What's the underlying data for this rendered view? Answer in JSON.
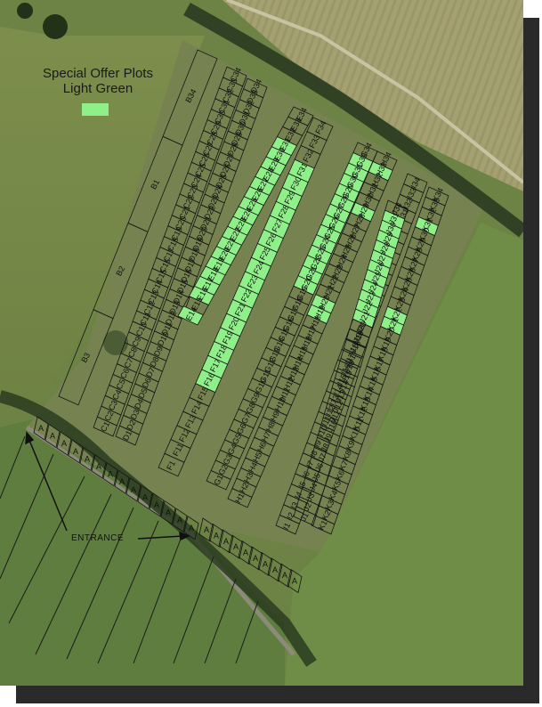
{
  "legend": {
    "line1": "Special Offer Plots",
    "line2": "Light Green",
    "swatch_color": "#8ff08a"
  },
  "entrance_label": "ENTRANCE",
  "plots": {
    "B": [
      "B34",
      "B1",
      "B2",
      "B3"
    ],
    "C": [
      "C34",
      "C33",
      "C32",
      "C31",
      "C30",
      "C29",
      "C28",
      "C27",
      "C26",
      "C25",
      "C24",
      "C23",
      "C22",
      "C21",
      "C20",
      "C19",
      "C18",
      "C17",
      "C16",
      "C15",
      "C14",
      "C13",
      "C12",
      "C11",
      "C10",
      "C9",
      "C8",
      "C7",
      "C6",
      "C5",
      "C4",
      "C3",
      "C2",
      "C1"
    ],
    "D": [
      "D34",
      "D33",
      "D32",
      "D31",
      "D30",
      "D29",
      "D28",
      "D27",
      "D26",
      "D25",
      "D24",
      "D23",
      "D22",
      "D21",
      "D20",
      "D19",
      "D18",
      "D17",
      "D16",
      "D15",
      "D14",
      "D13",
      "D12",
      "D11",
      "D10",
      "D9",
      "D8",
      "D7",
      "D6",
      "D5",
      "D4",
      "D3",
      "D2",
      "D1"
    ],
    "E": [
      "E34",
      "E33",
      "E32",
      "E31",
      "E30",
      "E29",
      "E28",
      "E27",
      "E26",
      "E25",
      "E24",
      "E23",
      "E22",
      "E21",
      "E20",
      "E19",
      "E18",
      "E17",
      "E16",
      "E15",
      "E14"
    ],
    "F": [
      "F34",
      "F33",
      "F32",
      "F31",
      "F30",
      "F29",
      "F28",
      "F27",
      "F26",
      "F25",
      "F24",
      "F23",
      "F22",
      "F21",
      "F20",
      "F19",
      "F18",
      "F17",
      "F16",
      "F15",
      "F14",
      "F13",
      "F12",
      "F11",
      "F1"
    ],
    "G": [
      "G34",
      "G33",
      "G31",
      "G30",
      "G29",
      "G28",
      "G27",
      "G26",
      "G25",
      "G24",
      "G23",
      "G22",
      "G21",
      "G20",
      "G19",
      "G18",
      "G17",
      "G16",
      "G15",
      "G14",
      "G13",
      "G12",
      "G11",
      "G10",
      "G9",
      "G8",
      "G7",
      "G6",
      "G5",
      "G4",
      "G3",
      "G2",
      "G1"
    ],
    "H": [
      "H34",
      "H33",
      "H32",
      "H31",
      "H30",
      "H29",
      "H28",
      "H27",
      "H26",
      "H25",
      "H24",
      "H23",
      "H22",
      "H21",
      "H20",
      "H19",
      "H18",
      "H17",
      "H16",
      "H15",
      "H14",
      "H13",
      "H12",
      "H11",
      "H10",
      "H9",
      "H8",
      "H7",
      "H6",
      "H5",
      "H4",
      "H3",
      "H2",
      "H1"
    ],
    "I": [
      "I34",
      "I33",
      "I32",
      "I31",
      "I30",
      "I29",
      "I28",
      "I27",
      "I26",
      "I25",
      "I24",
      "I23",
      "I22",
      "I21",
      "I20",
      "I19",
      "I18",
      "I17",
      "I16",
      "I15",
      "I14",
      "I13",
      "I12",
      "I11",
      "I10",
      "I9",
      "I8",
      "I7",
      "I6",
      "I5",
      "I4",
      "I3",
      "I2",
      "I1"
    ],
    "J": [
      "J34",
      "J31",
      "J30",
      "J29",
      "J28",
      "J27",
      "J26",
      "J25",
      "J24",
      "J23",
      "J22",
      "J21",
      "J20",
      "J19",
      "J18",
      "J17",
      "J16",
      "J15",
      "J14",
      "J13",
      "J12",
      "J11",
      "J10",
      "J9",
      "J8",
      "J7",
      "J6",
      "J5",
      "J4",
      "J3",
      "J2",
      "J1"
    ],
    "K": [
      "K34",
      "K33",
      "K32",
      "K31",
      "K30",
      "K29",
      "K28",
      "K27",
      "K26",
      "K25",
      "K24",
      "K23",
      "K22",
      "K21",
      "K20",
      "K19",
      "K18",
      "K17",
      "K16",
      "K15",
      "K14",
      "K13",
      "K12",
      "K11",
      "K10",
      "K9",
      "K8",
      "K7",
      "K6",
      "K5",
      "K4",
      "K3",
      "K2",
      "K1"
    ],
    "A": [
      "A",
      "A",
      "A",
      "A",
      "A",
      "A",
      "A",
      "A",
      "A",
      "A",
      "A",
      "A",
      "A",
      "A",
      "A",
      "A",
      "A",
      "A",
      "A",
      "A",
      "A",
      "A",
      "A",
      "A"
    ]
  },
  "special_offer": [
    "E31",
    "F31",
    "E30",
    "F30",
    "E29",
    "F29",
    "E28",
    "F28",
    "E27",
    "F27",
    "E26",
    "F26",
    "E25",
    "F25",
    "E24",
    "F24",
    "E23",
    "F23",
    "E22",
    "F22",
    "E21",
    "F21",
    "E20",
    "F20",
    "E19",
    "F19",
    "E18",
    "F18",
    "E17",
    "F17",
    "E16",
    "F16",
    "E14",
    "G33",
    "H33",
    "G31",
    "G30",
    "G29",
    "H29",
    "G28",
    "G27",
    "G26",
    "G25",
    "G24",
    "G23",
    "G22",
    "G21",
    "G20",
    "H20",
    "H19",
    "J31",
    "K31",
    "J30",
    "J29",
    "J28",
    "J27",
    "J26",
    "J25",
    "J24",
    "J23",
    "J22",
    "K22",
    "J21",
    "K21"
  ]
}
